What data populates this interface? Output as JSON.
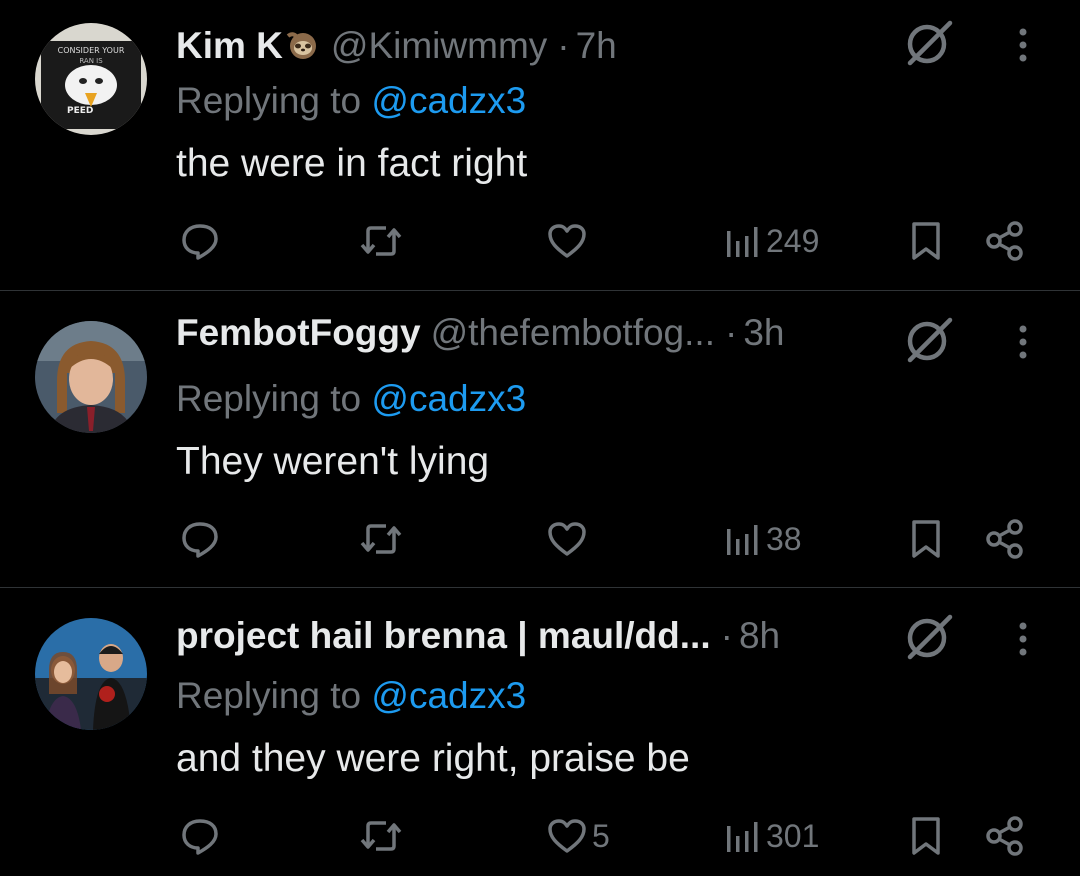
{
  "replies": [
    {
      "name": "Kim K",
      "handle": "@Kimiwmmy",
      "time": "7h",
      "replying_prefix": "Replying to ",
      "replying_to": "@cadzx3",
      "text": "the were in fact right",
      "likes": "",
      "views": "249",
      "avatar_text_top": "CONSIDER YOUR",
      "avatar_text_mid": "RAN IS",
      "avatar_text_bottom": "PEED"
    },
    {
      "name": "FembotFoggy",
      "handle": "@thefembotfog...",
      "time": "3h",
      "replying_prefix": "Replying to ",
      "replying_to": "@cadzx3",
      "text": "They weren't lying",
      "likes": "",
      "views": "38"
    },
    {
      "name": "project hail brenna | maul/dd...",
      "handle": "",
      "time": "8h",
      "replying_prefix": "Replying to ",
      "replying_to": "@cadzx3",
      "text": "and they were right, praise be",
      "likes": "5",
      "views": "301"
    }
  ],
  "icons": {
    "reply": "speech-bubble-icon",
    "repost": "repost-arrows-icon",
    "like": "heart-icon",
    "views": "bar-chart-icon",
    "bookmark": "bookmark-icon",
    "share": "share-icon",
    "grok": "slashed-circle-icon",
    "more": "vertical-dots-icon",
    "emoji": "sloth-emoji"
  },
  "colors": {
    "background": "#000000",
    "text": "#e7e9ea",
    "muted": "#71767b",
    "mention": "#1d9bf0",
    "divider": "#2f3336"
  }
}
